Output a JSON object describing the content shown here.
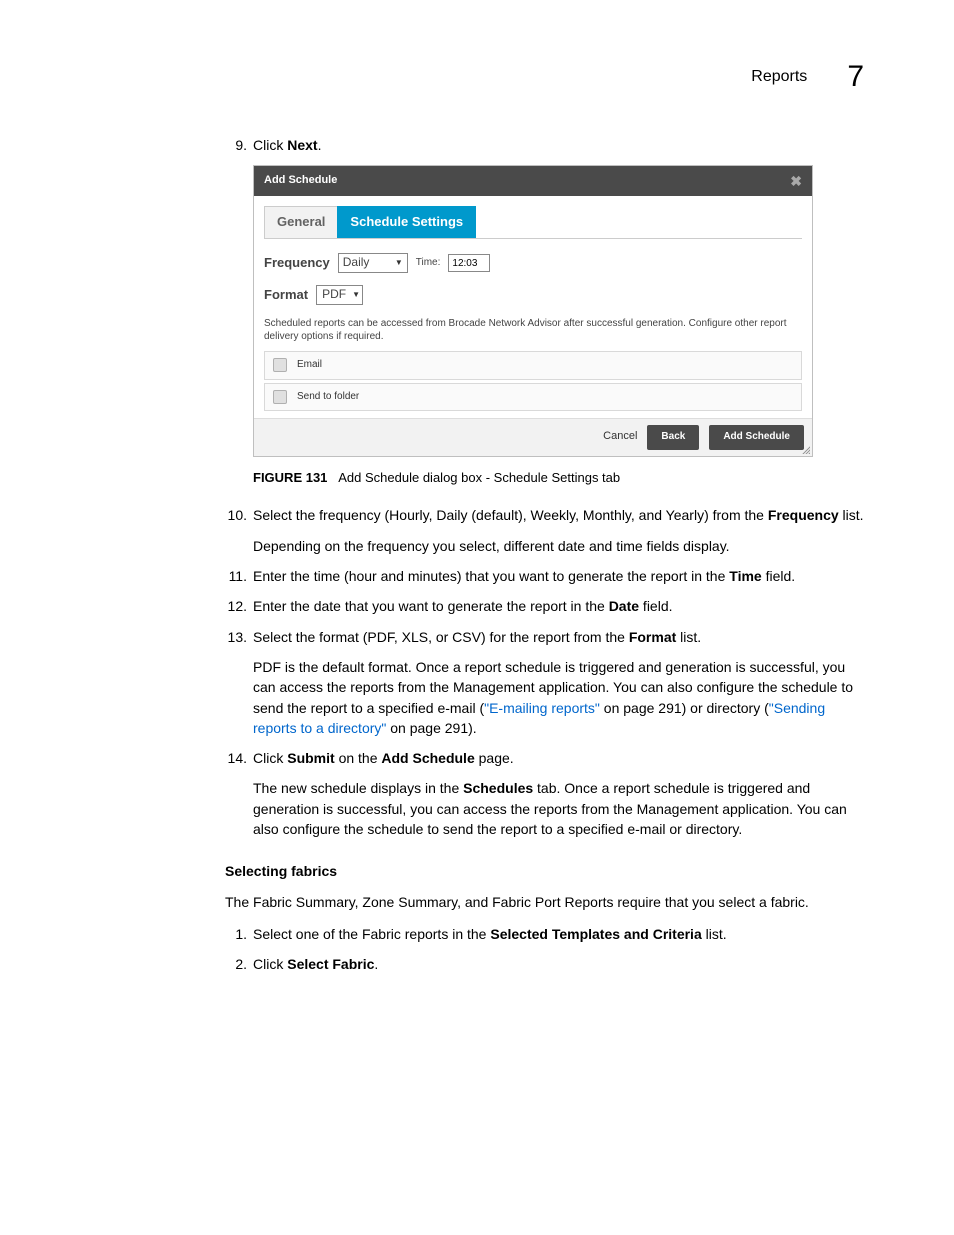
{
  "header": {
    "section": "Reports",
    "chapter_number": "7"
  },
  "step9": {
    "num": "9.",
    "pre": "Click ",
    "bold": "Next",
    "post": "."
  },
  "dialog": {
    "title": "Add Schedule",
    "close_glyph": "✖",
    "tabs": {
      "general": "General",
      "schedule": "Schedule Settings"
    },
    "frequency_label": "Frequency",
    "frequency_value": "Daily",
    "time_label": "Time:",
    "time_value": "12:03",
    "format_label": "Format",
    "format_value": "PDF",
    "info_text": "Scheduled reports can be accessed from Brocade Network Advisor after successful generation. Configure other report delivery options if required.",
    "option_email": "Email",
    "option_folder": "Send to folder",
    "actions": {
      "cancel": "Cancel",
      "back": "Back",
      "add": "Add Schedule"
    }
  },
  "figure_caption": {
    "num": "FIGURE 131",
    "text": "Add Schedule dialog box - Schedule Settings tab"
  },
  "step10": {
    "num": "10.",
    "pre": "Select the frequency (Hourly, Daily (default), Weekly, Monthly, and Yearly) from the ",
    "bold": "Frequency",
    "post": " list.",
    "sub": "Depending on the frequency you select, different date and time fields display."
  },
  "step11": {
    "num": "11.",
    "pre": "Enter the time (hour and minutes) that you want to generate the report in the ",
    "bold": "Time",
    "post": " field."
  },
  "step12": {
    "num": "12.",
    "pre": "Enter the date that you want to generate the report in the ",
    "bold": "Date",
    "post": " field."
  },
  "step13": {
    "num": "13.",
    "pre": "Select the format (PDF, XLS, or CSV) for the report from the ",
    "bold": "Format",
    "post": " list.",
    "sub_a": "PDF is the default format. Once a report schedule is triggered and generation is successful, you can access the reports from the Management application. You can also configure the schedule to send the report to a specified e-mail (",
    "link1": "\"E-mailing reports\"",
    "sub_b": " on page 291) or directory (",
    "link2": "\"Sending reports to a directory\"",
    "sub_c": " on page 291)."
  },
  "step14": {
    "num": "14.",
    "pre": "Click ",
    "bold1": "Submit",
    "mid": " on the ",
    "bold2": "Add Schedule",
    "post": " page.",
    "sub_a": "The new schedule displays in the ",
    "bold3": "Schedules",
    "sub_b": " tab. Once a report schedule is triggered and generation is successful, you can access the reports from the Management application. You can also configure the schedule to send the report to a specified e-mail or directory."
  },
  "section": {
    "heading": "Selecting fabrics",
    "intro": "The Fabric Summary, Zone Summary, and Fabric Port Reports require that you select a fabric.",
    "s1": {
      "num": "1.",
      "pre": "Select one of the Fabric reports in the ",
      "bold": "Selected Templates and Criteria",
      "post": " list."
    },
    "s2": {
      "num": "2.",
      "pre": "Click ",
      "bold": "Select Fabric",
      "post": "."
    }
  }
}
